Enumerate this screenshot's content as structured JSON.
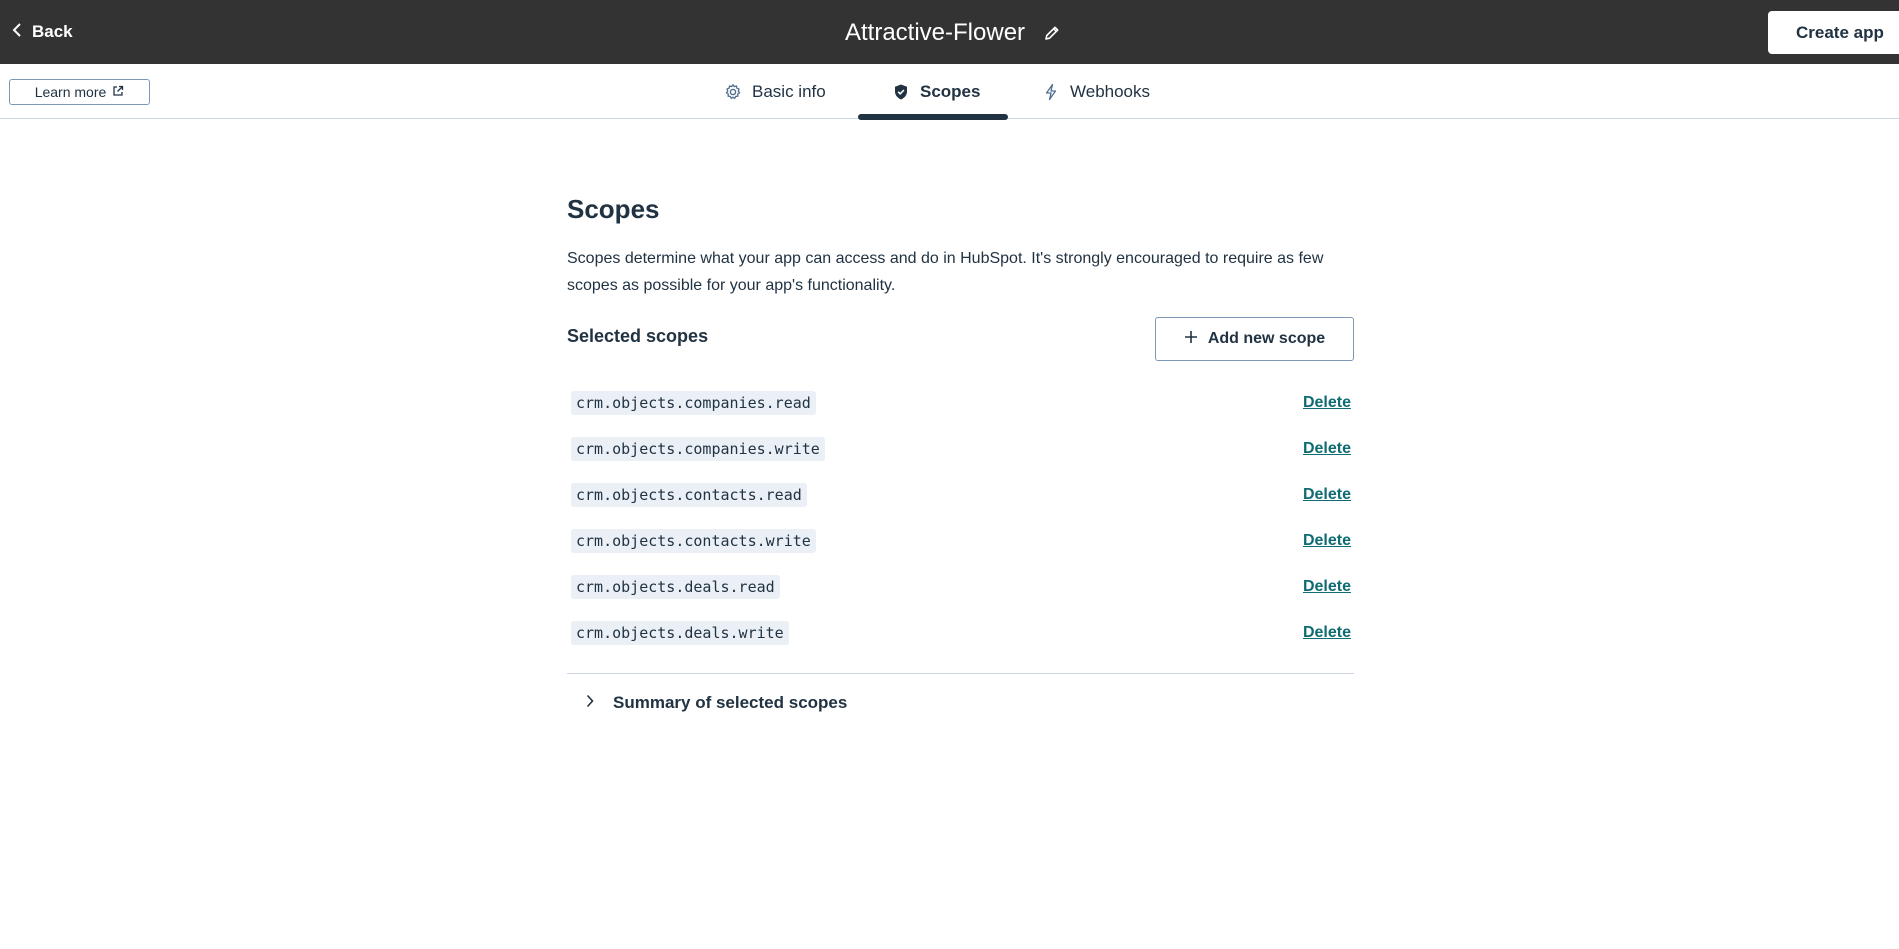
{
  "header": {
    "back_label": "Back",
    "app_name": "Attractive-Flower",
    "create_label": "Create app"
  },
  "tabbar": {
    "learn_more_label": "Learn more",
    "tabs": [
      {
        "label": "Basic info",
        "icon": "gear-icon",
        "active": false
      },
      {
        "label": "Scopes",
        "icon": "shield-check-icon",
        "active": true
      },
      {
        "label": "Webhooks",
        "icon": "lightning-icon",
        "active": false
      }
    ]
  },
  "main": {
    "title": "Scopes",
    "description": "Scopes determine what your app can access and do in HubSpot. It's strongly encouraged to require as few scopes as possible for your app's functionality.",
    "selected_heading": "Selected scopes",
    "add_scope_label": "Add new scope",
    "delete_label": "Delete",
    "scopes": [
      "crm.objects.companies.read",
      "crm.objects.companies.write",
      "crm.objects.contacts.read",
      "crm.objects.contacts.write",
      "crm.objects.deals.read",
      "crm.objects.deals.write"
    ],
    "summary_label": "Summary of selected scopes"
  },
  "colors": {
    "topbar": "#333333",
    "text": "#213343",
    "link": "#0f6c72",
    "code_bg": "#eaf0f6",
    "border": "#cbd6e2"
  }
}
